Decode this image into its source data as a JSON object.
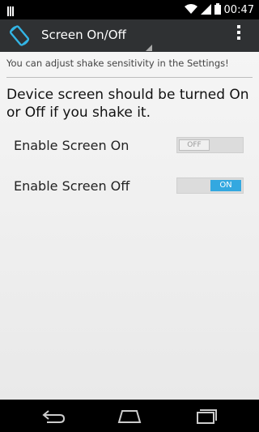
{
  "status_bar": {
    "time": "00:47",
    "icons": [
      "notification-icon",
      "wifi-icon",
      "signal-icon",
      "battery-icon"
    ]
  },
  "action_bar": {
    "title": "Screen On/Off",
    "app_icon": "screen-rotate-icon",
    "overflow_icon": "more-vert-icon"
  },
  "content": {
    "hint": "You can adjust shake sensitivity in the Settings!",
    "description": "Device screen should be turned On or Off if you shake it.",
    "settings": [
      {
        "label": "Enable Screen On",
        "state": "OFF"
      },
      {
        "label": "Enable Screen Off",
        "state": "ON"
      }
    ]
  },
  "nav_bar": {
    "buttons": [
      "back-icon",
      "home-icon",
      "recents-icon"
    ]
  },
  "colors": {
    "action_bar": "#2f3133",
    "toggle_on": "#33a8e0",
    "icon_accent": "#33b5e5"
  }
}
